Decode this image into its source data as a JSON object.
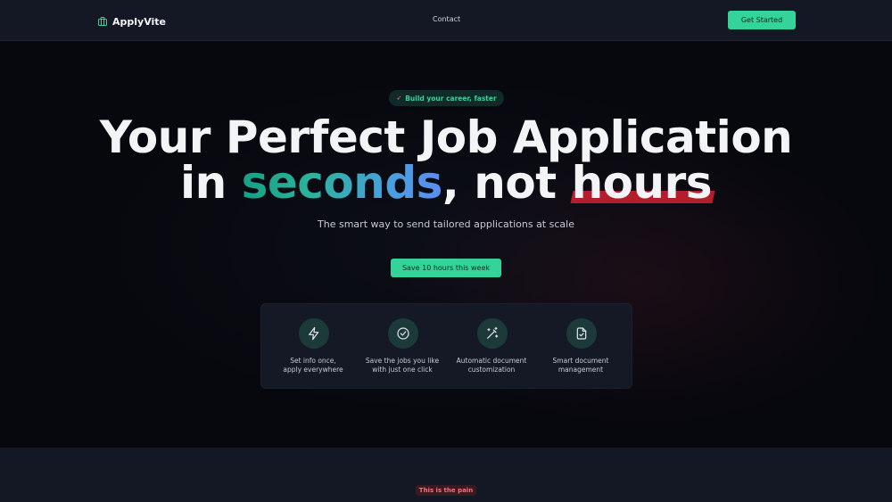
{
  "header": {
    "brand": "ApplyVite",
    "nav_contact": "Contact",
    "cta": "Get Started"
  },
  "hero": {
    "badge_icon": "rocket-icon",
    "badge": "Build your career, faster",
    "headline_line1": "Your Perfect Job Application",
    "headline_in": "in",
    "headline_seconds": "seconds",
    "headline_not": ", not",
    "headline_hours": "hours",
    "subtitle": "The smart way to send tailored applications at scale",
    "cta": "Save 10 hours this week"
  },
  "features": [
    {
      "icon": "lightning-icon",
      "line1": "Set info once,",
      "line2": "apply everywhere"
    },
    {
      "icon": "check-circle-icon",
      "line1": "Save the jobs you like",
      "line2": "with just one click"
    },
    {
      "icon": "magic-wand-icon",
      "line1": "Automatic document",
      "line2": "customization"
    },
    {
      "icon": "document-check-icon",
      "line1": "Smart document",
      "line2": "management"
    }
  ],
  "pain": {
    "badge": "This is the pain"
  },
  "colors": {
    "accent": "#34d399",
    "highlight_red": "#b41e2a",
    "background": "#07080e",
    "header_bg": "#141824"
  }
}
